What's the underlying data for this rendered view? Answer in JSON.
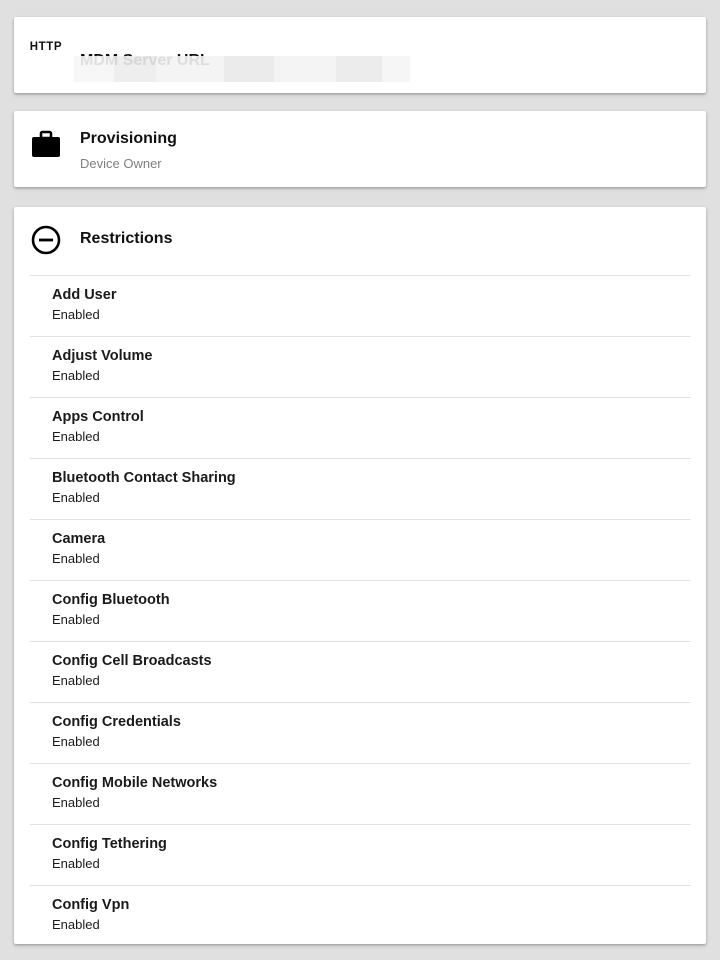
{
  "mdm_server": {
    "icon": "http-icon",
    "icon_text": "HTTP",
    "title": "MDM Server URL"
  },
  "provisioning": {
    "icon": "briefcase-icon",
    "title": "Provisioning",
    "subtitle": "Device Owner"
  },
  "restrictions": {
    "icon": "minus-circle-icon",
    "title": "Restrictions",
    "items": [
      {
        "name": "Add User",
        "value": "Enabled"
      },
      {
        "name": "Adjust Volume",
        "value": "Enabled"
      },
      {
        "name": "Apps Control",
        "value": "Enabled"
      },
      {
        "name": "Bluetooth Contact Sharing",
        "value": "Enabled"
      },
      {
        "name": "Camera",
        "value": "Enabled"
      },
      {
        "name": "Config Bluetooth",
        "value": "Enabled"
      },
      {
        "name": "Config Cell Broadcasts",
        "value": "Enabled"
      },
      {
        "name": "Config Credentials",
        "value": "Enabled"
      },
      {
        "name": "Config Mobile Networks",
        "value": "Enabled"
      },
      {
        "name": "Config Tethering",
        "value": "Enabled"
      },
      {
        "name": "Config Vpn",
        "value": "Enabled"
      }
    ]
  }
}
